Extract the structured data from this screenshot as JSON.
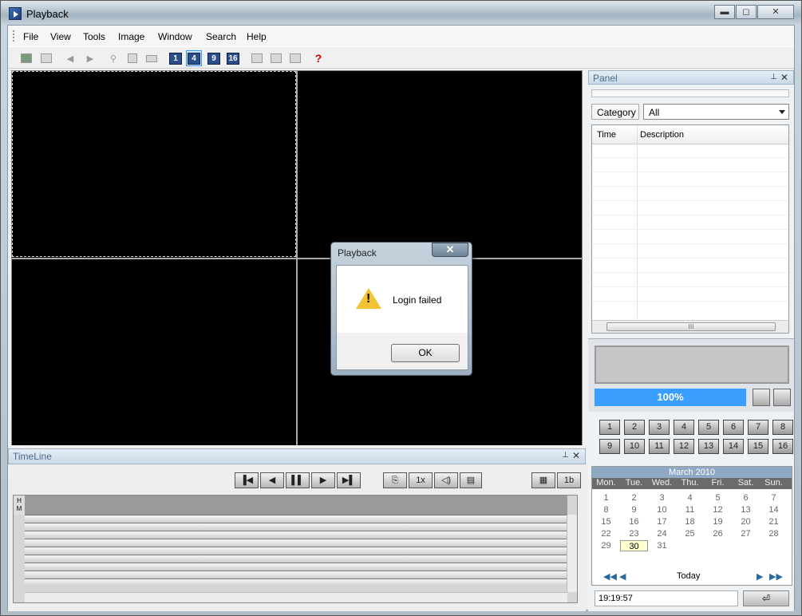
{
  "window": {
    "title": "Playback",
    "minimize": "▬",
    "restore": "◻",
    "close": "✕"
  },
  "menu": [
    "File",
    "View",
    "Tools",
    "Image",
    "Window",
    "Search",
    "Help"
  ],
  "toolbar": {
    "layout_buttons": [
      "1",
      "4",
      "9",
      "16"
    ],
    "help_icon": "?"
  },
  "timeline": {
    "title": "TimeLine",
    "pin": "⊥",
    "close": "✕",
    "hm_label": "H\nM",
    "controls": [
      "▐◀",
      "◀",
      "▌▌",
      "▶",
      "▶▌",
      "⎘",
      "1x",
      "◁)",
      "▤"
    ],
    "right_controls": [
      "▦",
      "1b"
    ]
  },
  "panel": {
    "title": "Panel",
    "pin": "⊥",
    "close": "✕",
    "category_label": "Category",
    "category_value": "All",
    "columns": [
      "Time",
      "Description"
    ],
    "hscroll_grip": "III",
    "progress": "100%",
    "progress_value": 1.0,
    "channels": [
      "1",
      "2",
      "3",
      "4",
      "5",
      "6",
      "7",
      "8",
      "9",
      "10",
      "11",
      "12",
      "13",
      "14",
      "15",
      "16"
    ]
  },
  "calendar": {
    "month": "March 2010",
    "dows": [
      "Mon.",
      "Tue.",
      "Wed.",
      "Thu.",
      "Fri.",
      "Sat.",
      "Sun."
    ],
    "days": [
      "1",
      "2",
      "3",
      "4",
      "5",
      "6",
      "7",
      "8",
      "9",
      "10",
      "11",
      "12",
      "13",
      "14",
      "15",
      "16",
      "17",
      "18",
      "19",
      "20",
      "21",
      "22",
      "23",
      "24",
      "25",
      "26",
      "27",
      "28",
      "29",
      "30",
      "31"
    ],
    "selected_day": "30",
    "today_label": "Today",
    "nav": [
      "◀◀",
      "◀",
      "▶",
      "▶▶"
    ]
  },
  "time_value": "19:19:57",
  "enter_icon": "⏎",
  "dialog": {
    "title": "Playback",
    "close": "✕",
    "message": "Login failed",
    "ok": "OK"
  }
}
